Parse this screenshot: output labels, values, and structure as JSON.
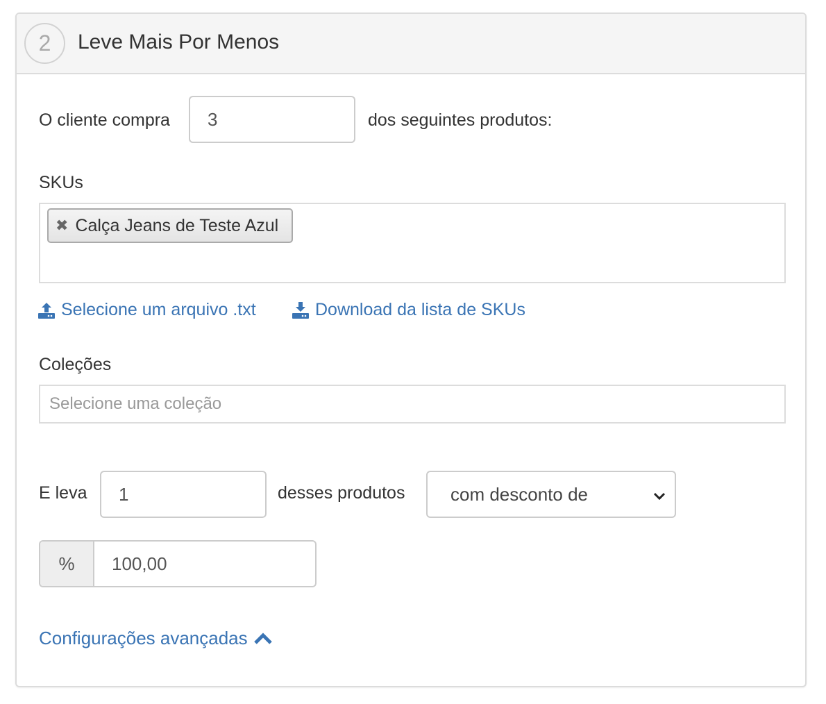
{
  "header": {
    "step_number": "2",
    "title": "Leve Mais Por Menos"
  },
  "buy": {
    "label_prefix": "O cliente compra",
    "quantity": "3",
    "label_suffix": "dos seguintes produtos:"
  },
  "skus": {
    "label": "SKUs",
    "tags": [
      {
        "remove_symbol": "✖",
        "label": "Calça Jeans de Teste Azul"
      }
    ],
    "upload_link": "Selecione um arquivo .txt",
    "download_link": "Download da lista de SKUs"
  },
  "collections": {
    "label": "Coleções",
    "placeholder": "Selecione uma coleção"
  },
  "take": {
    "label_prefix": "E leva",
    "quantity": "1",
    "label_middle": "desses produtos",
    "discount_select": "com desconto de"
  },
  "discount": {
    "unit": "%",
    "value": "100,00"
  },
  "advanced": {
    "label": "Configurações avançadas"
  },
  "colors": {
    "link": "#3a74b4",
    "header_bg": "#f5f5f5",
    "border": "#dcdcdc"
  }
}
